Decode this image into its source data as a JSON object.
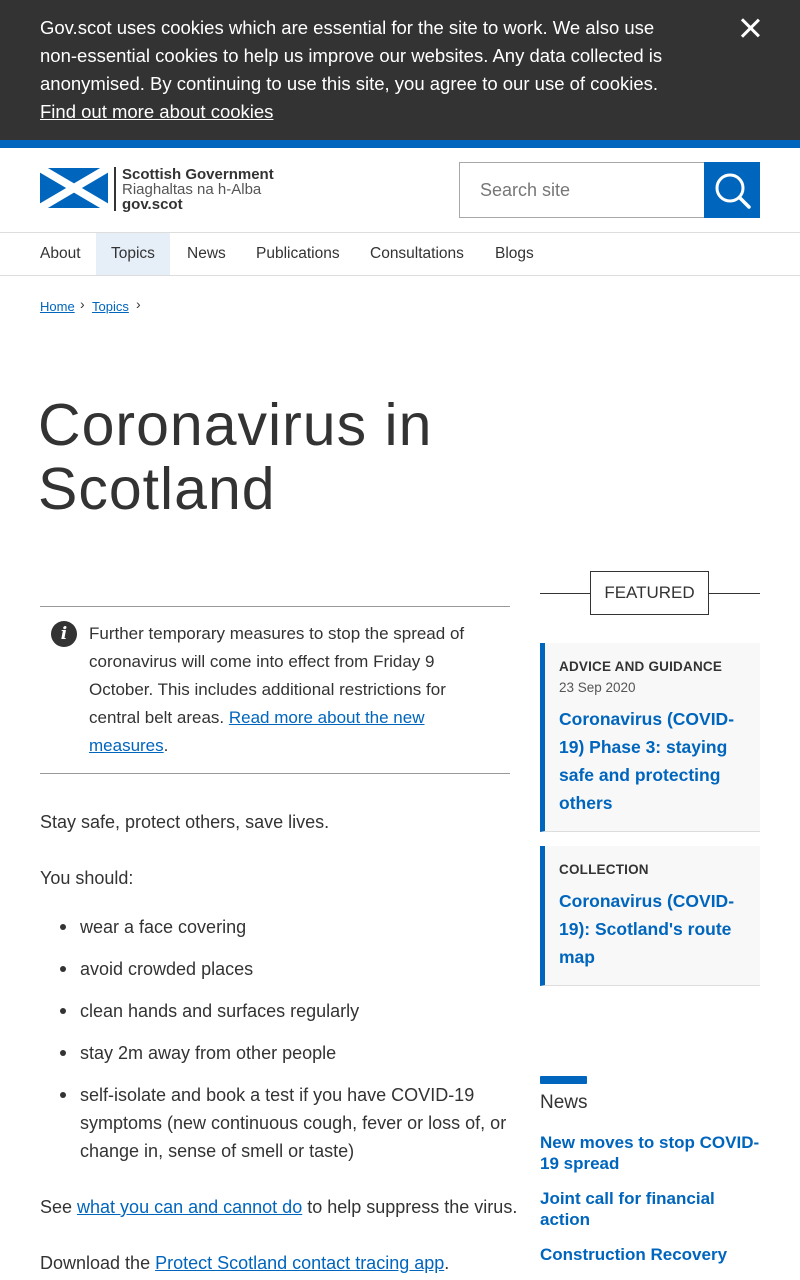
{
  "cookie_banner": {
    "text": "Gov.scot uses cookies which are essential for the site to work. We also use non-essential cookies to help us improve our websites. Any data collected is anonymised. By continuing to use this site, you agree to our use of cookies. ",
    "link": "Find out more about cookies"
  },
  "header": {
    "logo": {
      "line1": "Scottish Government",
      "line2": "Riaghaltas na h-Alba",
      "line3": "gov.scot"
    },
    "search_placeholder": "Search site"
  },
  "nav": {
    "items": [
      "About",
      "Topics",
      "News",
      "Publications",
      "Consultations",
      "Blogs"
    ],
    "active": "Topics"
  },
  "breadcrumb": [
    "Home",
    "Topics"
  ],
  "page_title": "Coronavirus in Scotland",
  "notice": {
    "text": "Further temporary measures to stop the spread of coronavirus will come into effect from Friday 9 October. This includes additional restrictions for central belt areas. ",
    "link": "Read more about the new measures",
    "end": "."
  },
  "main": {
    "intro": "Stay safe, protect others, save lives.",
    "you_should": "You should:",
    "bullets": [
      "wear a face covering",
      "avoid crowded places",
      "clean hands and surfaces regularly",
      "stay 2m away from other people",
      "self-isolate and book a test if you have COVID-19 symptoms (new continuous cough, fever or loss of, or change in, sense of smell or taste)"
    ],
    "see_prefix": "See ",
    "see_link": "what you can and cannot do",
    "see_suffix": " to help suppress the virus.",
    "download_prefix": "Download the ",
    "download_link": "Protect Scotland contact tracing app",
    "download_suffix": "."
  },
  "featured": {
    "heading": "FEATURED",
    "cards": [
      {
        "type": "ADVICE AND GUIDANCE",
        "date": "23 Sep 2020",
        "title": "Coronavirus (COVID-19) Phase 3: staying safe and protecting others"
      },
      {
        "type": "COLLECTION",
        "title": "Coronavirus (COVID-19): Scotland's route map"
      }
    ]
  },
  "news": {
    "heading": "News",
    "items": [
      "New moves to stop COVID-19 spread",
      "Joint call for financial action",
      "Construction Recovery"
    ]
  },
  "colors": {
    "brand_blue": "#0065bd",
    "banner_bg": "#333333",
    "nav_active_bg": "#e6eef8"
  },
  "icons": [
    "close-icon",
    "saltire-flag-icon",
    "search-icon",
    "chevron-right-icon",
    "info-icon"
  ]
}
